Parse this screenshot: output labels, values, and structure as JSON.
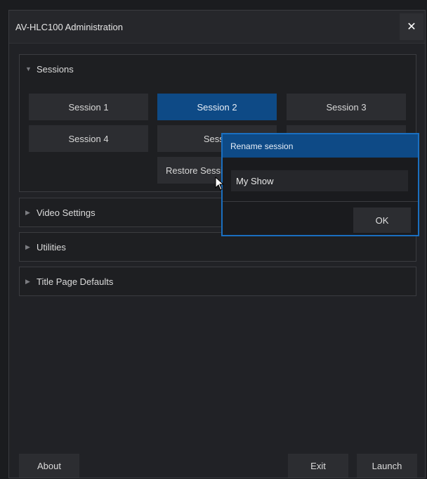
{
  "window": {
    "title": "AV-HLC100 Administration",
    "close_glyph": "✕"
  },
  "sessions": {
    "label": "Sessions",
    "expanded": true,
    "buttons": [
      "Session 1",
      "Session 2",
      "Session 3",
      "Session 4",
      "Sessic",
      "Restore Sessi"
    ],
    "active_index": 1
  },
  "sections": [
    {
      "label": "Video Settings",
      "expanded": false
    },
    {
      "label": "Utilities",
      "expanded": false
    },
    {
      "label": "Title Page Defaults",
      "expanded": false
    }
  ],
  "footer": {
    "about": "About",
    "exit": "Exit",
    "launch": "Launch"
  },
  "dialog": {
    "title": "Rename session",
    "input_value": "My Show",
    "ok_label": "OK"
  },
  "colors": {
    "accent": "#0e4a86",
    "dialog_border": "#1a6fc0",
    "background": "#212226"
  },
  "icons": {
    "expanded_caret": "caret-down-icon",
    "collapsed_caret": "caret-right-icon",
    "close": "close-icon",
    "cursor": "mouse-pointer-icon"
  }
}
